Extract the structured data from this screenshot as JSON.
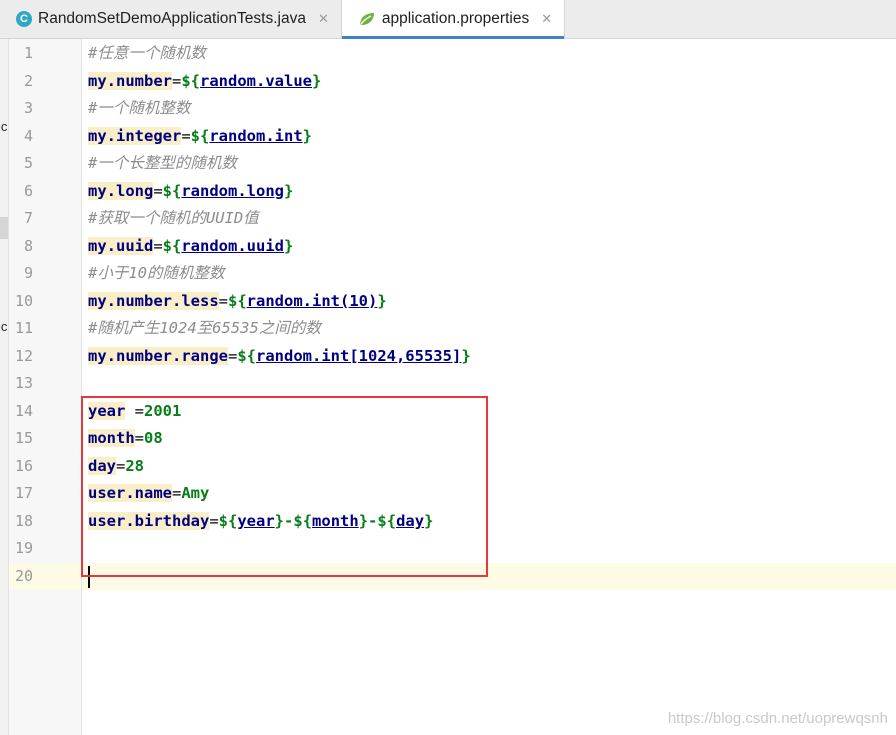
{
  "tabs": [
    {
      "label": "RandomSetDemoApplicationTests.java",
      "icon": "java-class-icon",
      "active": false
    },
    {
      "label": "application.properties",
      "icon": "spring-leaf-icon",
      "active": true
    }
  ],
  "editor": {
    "current_line": 20,
    "lines": [
      {
        "no": "1",
        "comment": "#任意一个随机数"
      },
      {
        "no": "2",
        "key": "my.number",
        "value_parts": [
          {
            "t": "ph",
            "v": "${"
          },
          {
            "t": "ref",
            "v": "random.value"
          },
          {
            "t": "ph",
            "v": "}"
          }
        ]
      },
      {
        "no": "3",
        "comment": "#一个随机整数"
      },
      {
        "no": "4",
        "key": "my.integer",
        "value_parts": [
          {
            "t": "ph",
            "v": "${"
          },
          {
            "t": "ref",
            "v": "random.int"
          },
          {
            "t": "ph",
            "v": "}"
          }
        ]
      },
      {
        "no": "5",
        "comment": "#一个长整型的随机数"
      },
      {
        "no": "6",
        "key": "my.long",
        "value_parts": [
          {
            "t": "ph",
            "v": "${"
          },
          {
            "t": "ref",
            "v": "random.long"
          },
          {
            "t": "ph",
            "v": "}"
          }
        ]
      },
      {
        "no": "7",
        "comment": "#获取一个随机的UUID值"
      },
      {
        "no": "8",
        "key": "my.uuid",
        "value_parts": [
          {
            "t": "ph",
            "v": "${"
          },
          {
            "t": "ref",
            "v": "random.uuid"
          },
          {
            "t": "ph",
            "v": "}"
          }
        ]
      },
      {
        "no": "9",
        "comment": "#小于10的随机整数"
      },
      {
        "no": "10",
        "key": "my.number.less",
        "value_parts": [
          {
            "t": "ph",
            "v": "${"
          },
          {
            "t": "ref",
            "v": "random.int(10)"
          },
          {
            "t": "ph",
            "v": "}"
          }
        ]
      },
      {
        "no": "11",
        "comment": "#随机产生1024至65535之间的数"
      },
      {
        "no": "12",
        "key": "my.number.range",
        "value_parts": [
          {
            "t": "ph",
            "v": "${"
          },
          {
            "t": "ref",
            "v": "random.int[1024,65535]"
          },
          {
            "t": "ph",
            "v": "}"
          }
        ]
      },
      {
        "no": "13"
      },
      {
        "no": "14",
        "key": "year",
        "eq": " =",
        "value_parts": [
          {
            "t": "val",
            "v": "2001"
          }
        ]
      },
      {
        "no": "15",
        "key": "month",
        "value_parts": [
          {
            "t": "val",
            "v": "08"
          }
        ]
      },
      {
        "no": "16",
        "key": "day",
        "value_parts": [
          {
            "t": "val",
            "v": "28"
          }
        ]
      },
      {
        "no": "17",
        "key": "user.name",
        "value_parts": [
          {
            "t": "val",
            "v": "Amy"
          }
        ]
      },
      {
        "no": "18",
        "key": "user.birthday",
        "value_parts": [
          {
            "t": "ph",
            "v": "${"
          },
          {
            "t": "ref",
            "v": "year"
          },
          {
            "t": "ph",
            "v": "}"
          },
          {
            "t": "val",
            "v": "-"
          },
          {
            "t": "ph",
            "v": "${"
          },
          {
            "t": "ref",
            "v": "month"
          },
          {
            "t": "ph",
            "v": "}"
          },
          {
            "t": "val",
            "v": "-"
          },
          {
            "t": "ph",
            "v": "${"
          },
          {
            "t": "ref",
            "v": "day"
          },
          {
            "t": "ph",
            "v": "}"
          }
        ]
      },
      {
        "no": "19"
      },
      {
        "no": "20"
      }
    ]
  },
  "left_strip_chars": [
    "ic",
    "ic"
  ],
  "watermark": "https://blog.csdn.net/uoprewqsnh",
  "colors": {
    "accent": "#4083c9",
    "highlight_box": "#e8373d",
    "current_line": "#fdfae6"
  }
}
